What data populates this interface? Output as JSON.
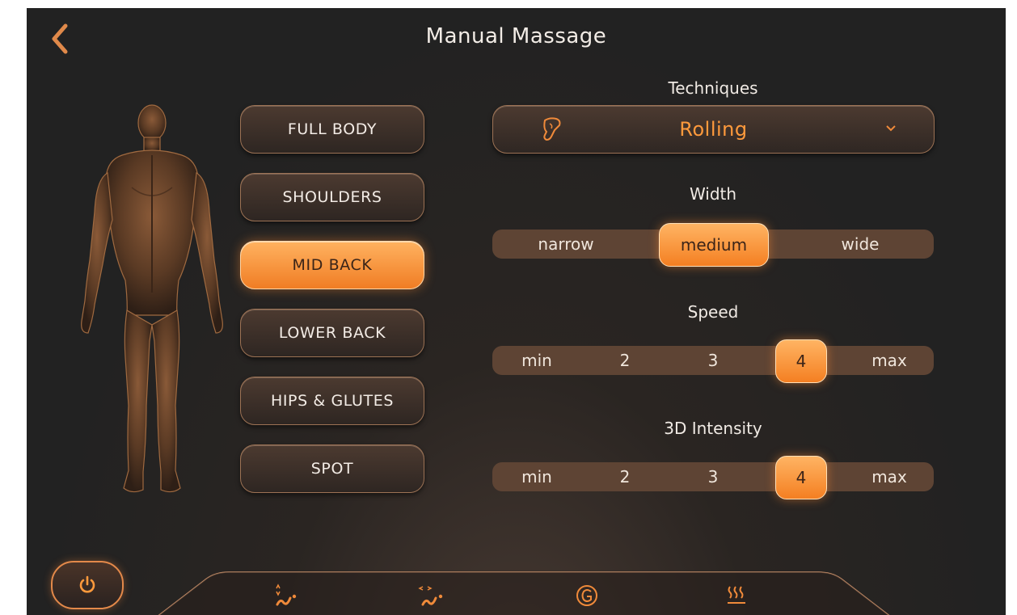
{
  "header": {
    "title": "Manual Massage"
  },
  "zones": [
    "FULL BODY",
    "SHOULDERS",
    "MID BACK",
    "LOWER BACK",
    "HIPS & GLUTES",
    "SPOT"
  ],
  "zone_selected": "MID BACK",
  "techniques": {
    "label": "Techniques",
    "selected": "Rolling"
  },
  "width": {
    "label": "Width",
    "options": [
      "narrow",
      "medium",
      "wide"
    ],
    "selected": "medium"
  },
  "speed": {
    "label": "Speed",
    "options": [
      "min",
      "2",
      "3",
      "4",
      "max"
    ],
    "selected": "4"
  },
  "intensity": {
    "label": "3D Intensity",
    "options": [
      "min",
      "2",
      "3",
      "4",
      "max"
    ],
    "selected": "4"
  },
  "bottom_icons": [
    "power-icon",
    "vertical-massage-icon",
    "horizontal-massage-icon",
    "g-mode-icon",
    "heat-icon"
  ],
  "colors": {
    "accent": "#f58a2c",
    "background": "#242222",
    "track": "#5e4434"
  }
}
